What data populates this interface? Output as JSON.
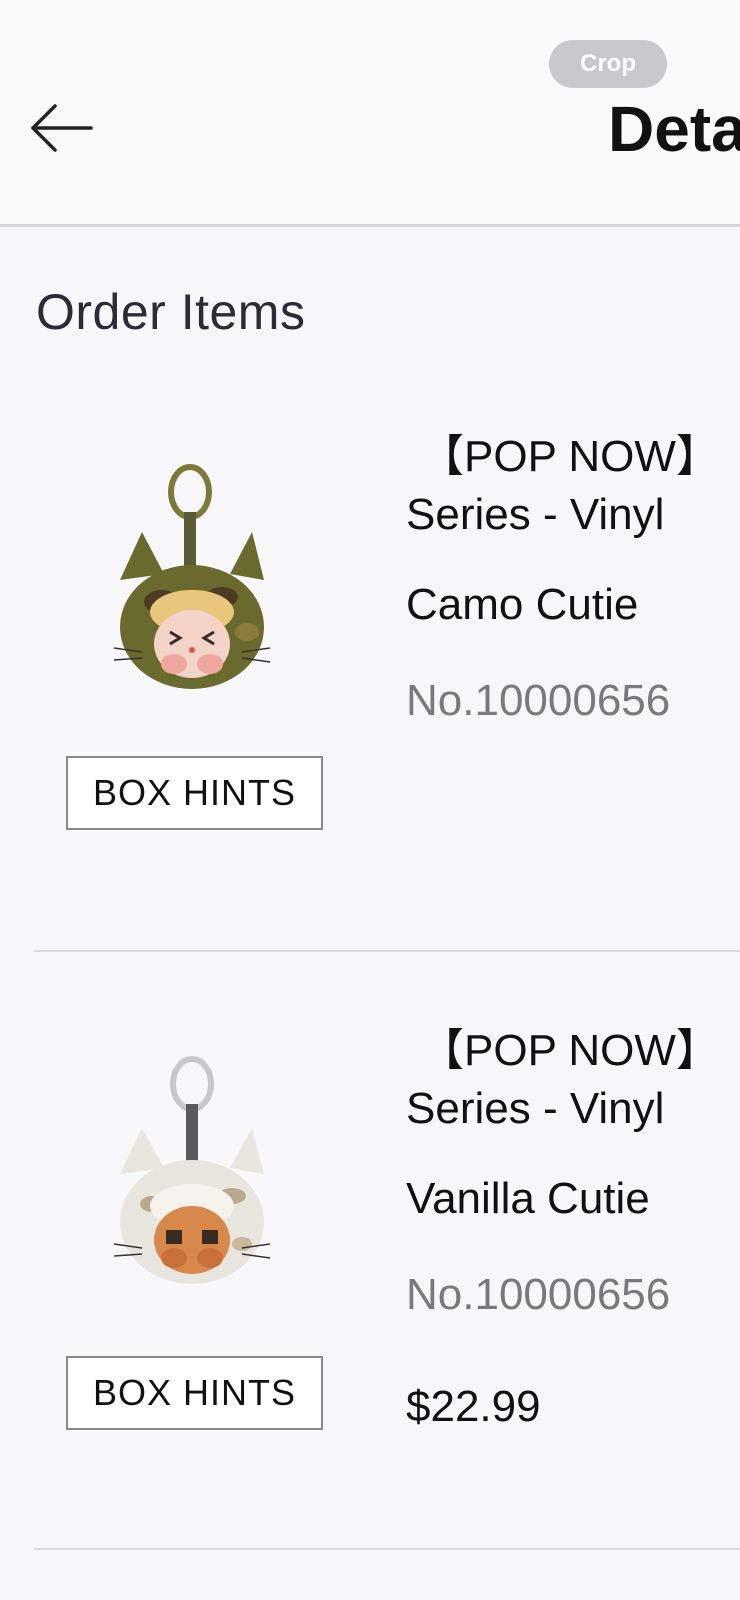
{
  "header": {
    "crop_label": "Crop",
    "title": "Deta",
    "back_icon": "arrow-left-icon"
  },
  "section": {
    "title": "Order Items"
  },
  "items": [
    {
      "brand": "【POP NOW】",
      "series": "Series - Vinyl",
      "variant": "Camo Cutie",
      "sku": "No.10000656",
      "box_hints_label": "BOX HINTS",
      "colors": {
        "fur": "#6b6a2e",
        "ring": "#7c7a3a"
      }
    },
    {
      "brand": "【POP NOW】",
      "series": "Series - Vinyl",
      "variant": "Vanilla Cutie",
      "sku": "No.10000656",
      "box_hints_label": "BOX HINTS",
      "price": "$22.99",
      "colors": {
        "fur": "#e9e6df",
        "ring": "#c8c8c8"
      }
    }
  ]
}
